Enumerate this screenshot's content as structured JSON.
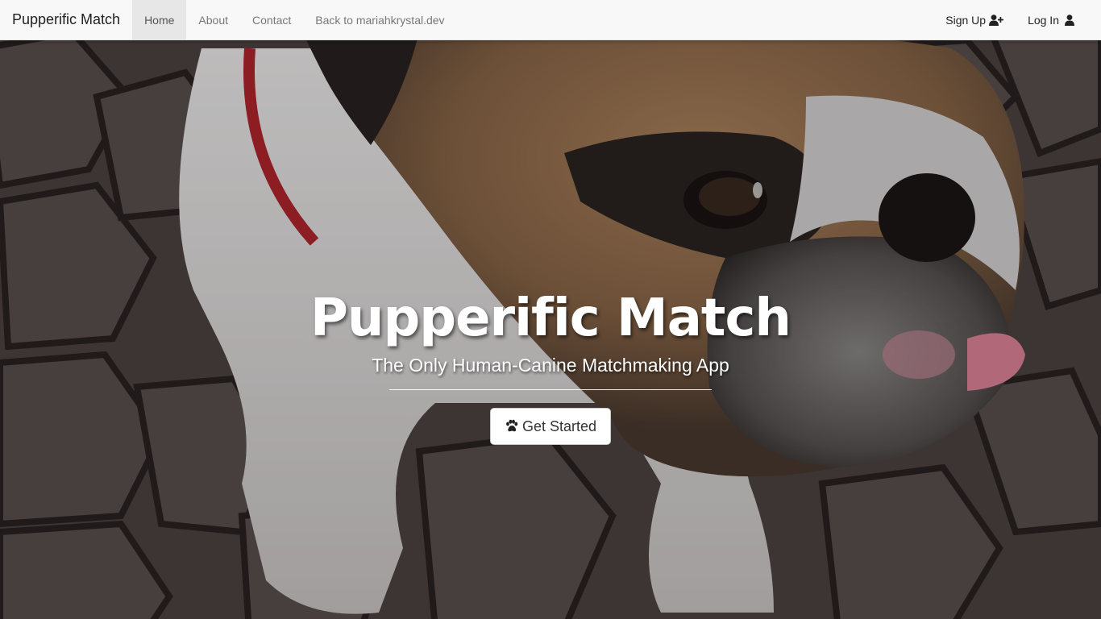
{
  "navbar": {
    "brand": "Pupperific Match",
    "links": [
      {
        "label": "Home",
        "active": true
      },
      {
        "label": "About",
        "active": false
      },
      {
        "label": "Contact",
        "active": false
      },
      {
        "label": "Back to mariahkrystal.dev",
        "active": false
      }
    ],
    "right": [
      {
        "label": "Sign Up",
        "icon": "user-plus-icon"
      },
      {
        "label": "Log In",
        "icon": "user-icon"
      }
    ]
  },
  "hero": {
    "background": "bulldog-photo",
    "title": "Pupperific Match",
    "subtitle": "The Only Human-Canine Matchmaking App",
    "cta_label": "Get Started",
    "cta_icon": "paw-icon"
  }
}
